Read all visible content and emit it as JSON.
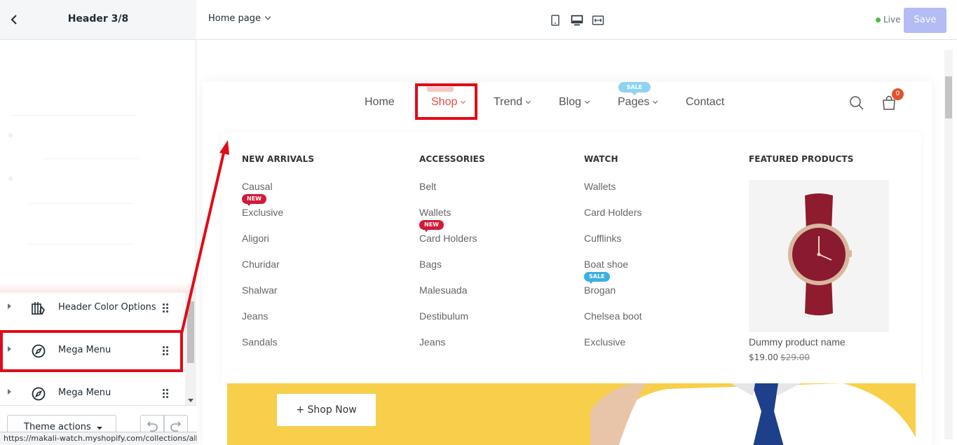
{
  "sidebar": {
    "title": "Header 3/8",
    "items": [
      {
        "label": "Header Color Options",
        "icon": "paint-sliders-icon"
      },
      {
        "label": "Mega Menu",
        "icon": "compass-icon"
      },
      {
        "label": "Mega Menu",
        "icon": "compass-icon"
      }
    ],
    "theme_actions_label": "Theme actions",
    "status_url": "https://makali-watch.myshopify.com/collections/all"
  },
  "topbar": {
    "page_select": "Home page",
    "live_label": "Live",
    "save_label": "Save"
  },
  "colors": {
    "highlight": "#e10b17",
    "accent_nav": "#e14b4b",
    "banner": "#f7cf4a",
    "new_badge": "#d21936",
    "sale_badge": "#3bb0e5",
    "save_disabled": "#b3bcf5"
  },
  "nav": {
    "items": [
      "Home",
      "Shop",
      "Trend",
      "Blog",
      "Pages",
      "Contact"
    ],
    "pages_badge": "SALE",
    "cart_count": "0"
  },
  "mega_menu": {
    "columns": [
      {
        "heading": "NEW ARRIVALS",
        "links": [
          "Causal",
          "Exclusive",
          "Aligori",
          "Churidar",
          "Shalwar",
          "Jeans",
          "Sandals"
        ]
      },
      {
        "heading": "ACCESSORIES",
        "links": [
          "Belt",
          "Wallets",
          "Card Holders",
          "Bags",
          "Malesuada",
          "Destibulum",
          "Jeans"
        ]
      },
      {
        "heading": "WATCH",
        "links": [
          "Wallets",
          "Card Holders",
          "Cufflinks",
          "Boat shoe",
          "Brogan",
          "Chelsea boot",
          "Exclusive"
        ]
      }
    ],
    "badges": {
      "new": "NEW",
      "sale": "SALE"
    },
    "featured": {
      "heading": "FEATURED PRODUCTS",
      "product_name": "Dummy product name",
      "price": "$19.00",
      "old_price": "$29.00"
    }
  },
  "banner": {
    "button_label": "Shop Now"
  }
}
